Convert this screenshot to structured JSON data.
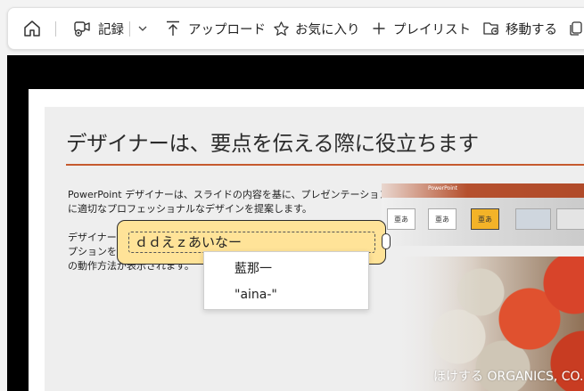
{
  "toolbar": {
    "record_label": "記録",
    "upload_label": "アップロード",
    "favorite_label": "お気に入り",
    "playlist_label": "プレイリスト",
    "move_label": "移動する"
  },
  "slide": {
    "title": "デザイナーは、要点を伝える際に役立ちます",
    "paragraph1": [
      "PowerPoint デザイナーは、スライドの内容を基に、プレゼンテーション",
      "に適切なプロフェッショナルなデザインを提案します。"
    ],
    "paragraph2": [
      "デザイナーは",
      "プションをお",
      "の動作方法が表示されます。"
    ],
    "thumbnails": [
      "亜あ",
      "亜あ",
      "亜あ"
    ],
    "bar_label": "PowerPoint",
    "banner_text": "ほけする ORGANICS, CO."
  },
  "ime": {
    "composition": "ｄｄえｚあいなー",
    "candidates": [
      "藍那一",
      "\"aina-\""
    ]
  },
  "colors": {
    "accent_rule": "#c65a2e",
    "ime_background": "#ffe398"
  }
}
